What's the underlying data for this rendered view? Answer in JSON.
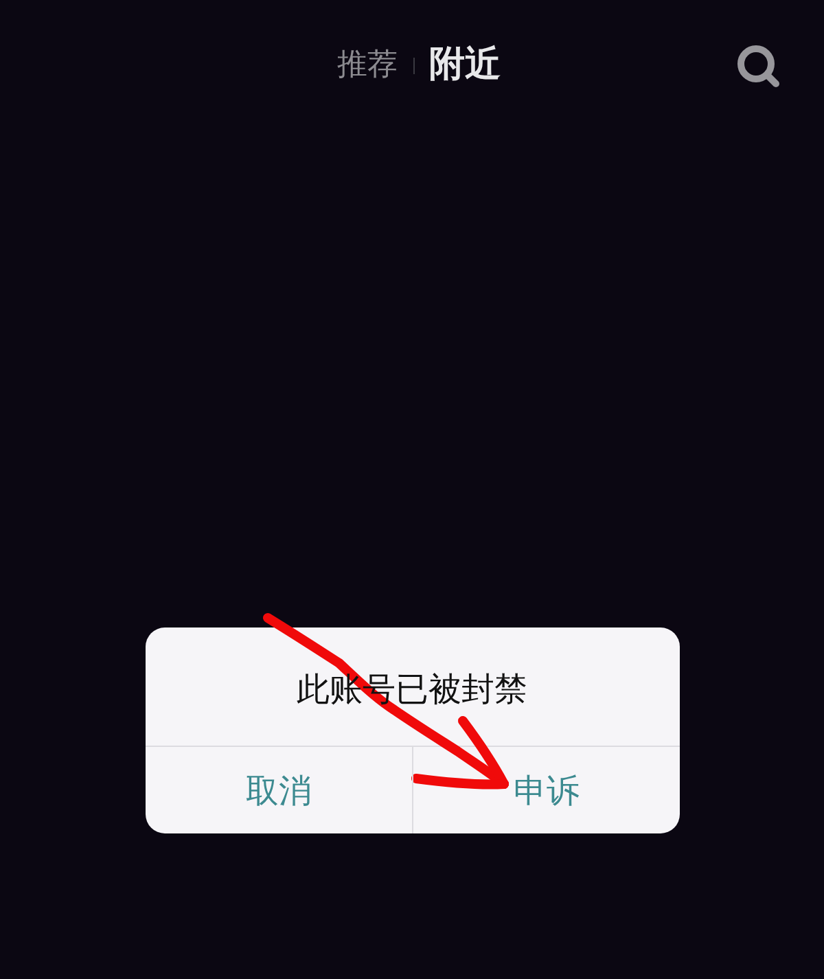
{
  "top_bar": {
    "tabs": [
      {
        "label": "推荐",
        "selected": false
      },
      {
        "label": "附近",
        "selected": true
      }
    ]
  },
  "dialog": {
    "title": "此账号已被封禁",
    "buttons": [
      {
        "label": "取消"
      },
      {
        "label": "申诉"
      }
    ]
  }
}
